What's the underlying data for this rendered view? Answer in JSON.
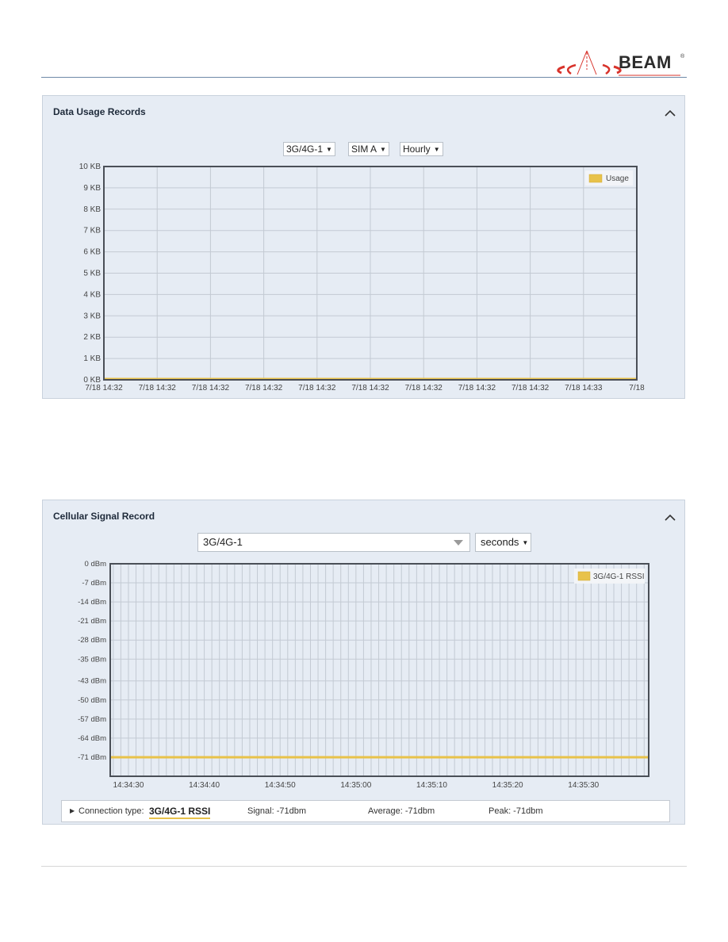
{
  "brand": {
    "name": "BEAM",
    "registered": "®",
    "accent_color": "#d8332b"
  },
  "usage_panel": {
    "title": "Data Usage Records",
    "collapse_icon": "chevron-up-icon",
    "selects": {
      "interface": "3G/4G-1",
      "sim": "SIM A",
      "period": "Hourly"
    }
  },
  "signal_panel": {
    "title": "Cellular Signal Record",
    "collapse_icon": "chevron-up-icon",
    "selects": {
      "interface": "3G/4G-1",
      "unit": "seconds"
    },
    "info": {
      "expand_icon": "triangle-right-icon",
      "connection_label": "Connection type:",
      "connection_value": "3G/4G-1 RSSI",
      "signal": "Signal: -71dbm",
      "average": "Average: -71dbm",
      "peak": "Peak: -71dbm"
    }
  },
  "chart_data": [
    {
      "type": "area",
      "title": "Data Usage Records",
      "xlabel": "",
      "ylabel": "",
      "y_ticks": [
        "0 KB",
        "1 KB",
        "2 KB",
        "3 KB",
        "4 KB",
        "5 KB",
        "6 KB",
        "7 KB",
        "8 KB",
        "9 KB",
        "10 KB"
      ],
      "ylim": [
        0,
        10
      ],
      "y_unit": "KB",
      "x_ticks": [
        "7/18 14:32",
        "7/18 14:32",
        "7/18 14:32",
        "7/18 14:32",
        "7/18 14:32",
        "7/18 14:32",
        "7/18 14:32",
        "7/18 14:32",
        "7/18 14:32",
        "7/18 14:33",
        "7/18"
      ],
      "grid": true,
      "legend": {
        "position": "top-right",
        "entries": [
          "Usage"
        ]
      },
      "series": [
        {
          "name": "Usage",
          "color": "#e8c24a",
          "values": [
            0,
            0,
            0,
            0,
            0,
            0,
            0,
            0,
            0,
            0,
            0
          ]
        }
      ]
    },
    {
      "type": "line",
      "title": "Cellular Signal Record",
      "xlabel": "",
      "ylabel": "",
      "y_ticks": [
        "0 dBm",
        "-7 dBm",
        "-14 dBm",
        "-21 dBm",
        "-28 dBm",
        "-35 dBm",
        "-43 dBm",
        "-50 dBm",
        "-57 dBm",
        "-64 dBm",
        "-71 dBm"
      ],
      "y_tick_values": [
        0,
        -7,
        -14,
        -21,
        -28,
        -35,
        -43,
        -50,
        -57,
        -64,
        -71
      ],
      "ylim": [
        -78,
        0
      ],
      "x_ticks": [
        "14:34:30",
        "14:34:40",
        "14:34:50",
        "14:35:00",
        "14:35:10",
        "14:35:20",
        "14:35:30"
      ],
      "x_range_seconds": [
        -2.4,
        68.6
      ],
      "grid": true,
      "legend": {
        "position": "top-right",
        "entries": [
          "3G/4G-1 RSSI"
        ]
      },
      "series": [
        {
          "name": "3G/4G-1 RSSI",
          "color": "#e8c24a",
          "values": [
            -71,
            -71,
            -71,
            -71,
            -71,
            -71,
            -71,
            -71
          ]
        }
      ]
    }
  ]
}
